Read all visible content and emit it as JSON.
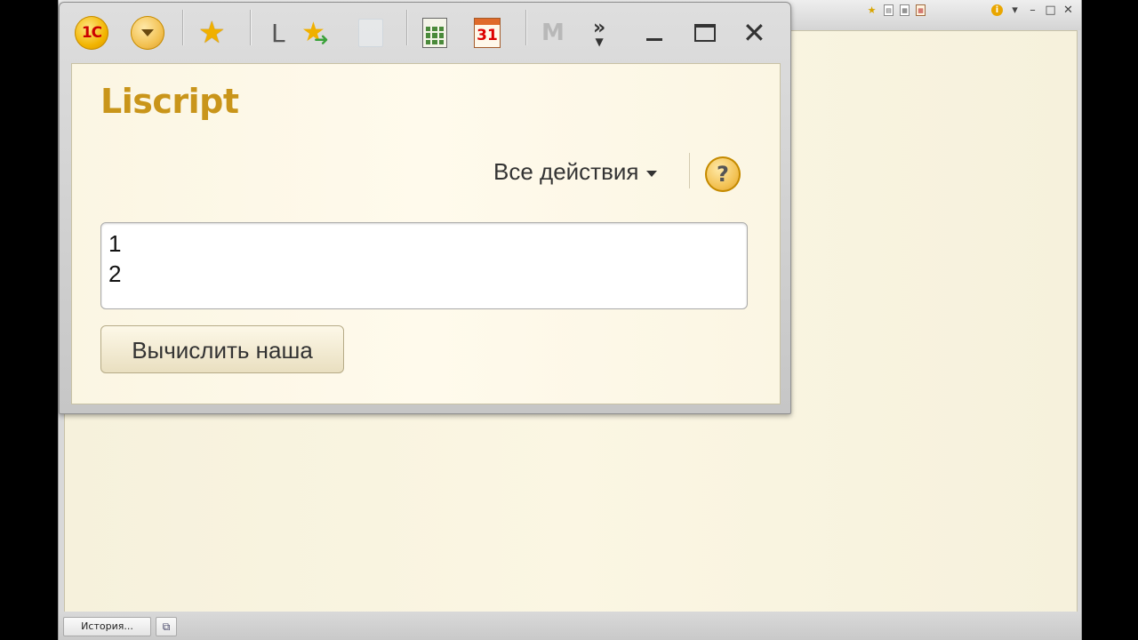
{
  "form": {
    "title": "Liscript",
    "all_actions_label": "Все действия",
    "help_label": "?",
    "text_area_value": "1\n2",
    "compute_button_label": "Вычислить наша"
  },
  "toolbar": {
    "logo_label": "1С",
    "letter_label": "L",
    "calendar_day": "31",
    "m_label": "M",
    "more_label": "»"
  },
  "statusbar": {
    "history_label": "История..."
  },
  "icons": {
    "logo": "1c-logo-icon",
    "main_menu": "main-menu-icon",
    "favorites": "star-icon",
    "add_favorite": "star-arrow-icon",
    "calculator": "calculator-icon",
    "calendar": "calendar-icon",
    "help": "question-icon"
  },
  "colors": {
    "title": "#c9951a",
    "form_background": "#fbf6e3",
    "accent_orange": "#f2b400"
  }
}
